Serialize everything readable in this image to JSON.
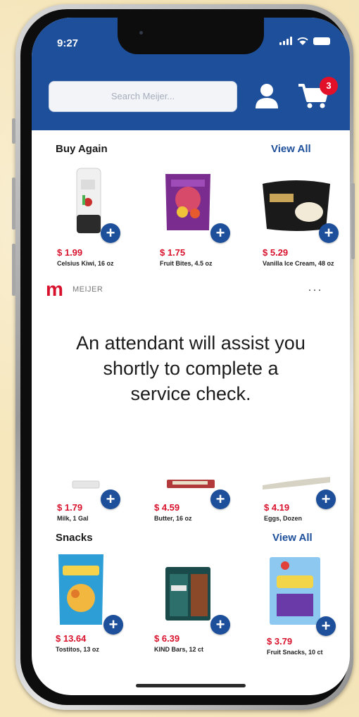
{
  "status_bar": {
    "time": "9:27"
  },
  "header": {
    "search_placeholder": "Search Meijer...",
    "cart_count": "3",
    "bg_color": "#1d4f9a"
  },
  "buy_again": {
    "title": "Buy Again",
    "view_all": "View All",
    "items": [
      {
        "price": "$ 1.99",
        "name": "Celsius Kiwi, 16 oz"
      },
      {
        "price": "$ 1.75",
        "name": "Fruit Bites, 4.5 oz"
      },
      {
        "price": "$ 5.29",
        "name": "Vanilla Ice Cream, 48 oz"
      }
    ]
  },
  "ad": {
    "logo": "m",
    "brand": "MEIJER",
    "more": "···",
    "message": "An attendant will assist you shortly to complete a service check."
  },
  "staples": {
    "items": [
      {
        "price": "$ 1.79",
        "name": "Milk, 1 Gal"
      },
      {
        "price": "$ 4.59",
        "name": "Butter, 16 oz"
      },
      {
        "price": "$ 4.19",
        "name": "Eggs, Dozen"
      }
    ]
  },
  "snacks": {
    "title": "Snacks",
    "view_all": "View All",
    "items": [
      {
        "price": "$ 13.64",
        "name": "Tostitos, 13 oz"
      },
      {
        "price": "$ 6.39",
        "name": "KIND Bars, 12 ct"
      },
      {
        "price": "$ 3.79",
        "name": "Fruit Snacks, 10 ct"
      }
    ]
  },
  "icons": [
    "user-icon",
    "cart-icon",
    "plus-icon",
    "more-icon"
  ],
  "colors": {
    "brand_blue": "#1d4f9a",
    "price_red": "#d8102b",
    "badge_red": "#e3102a"
  }
}
